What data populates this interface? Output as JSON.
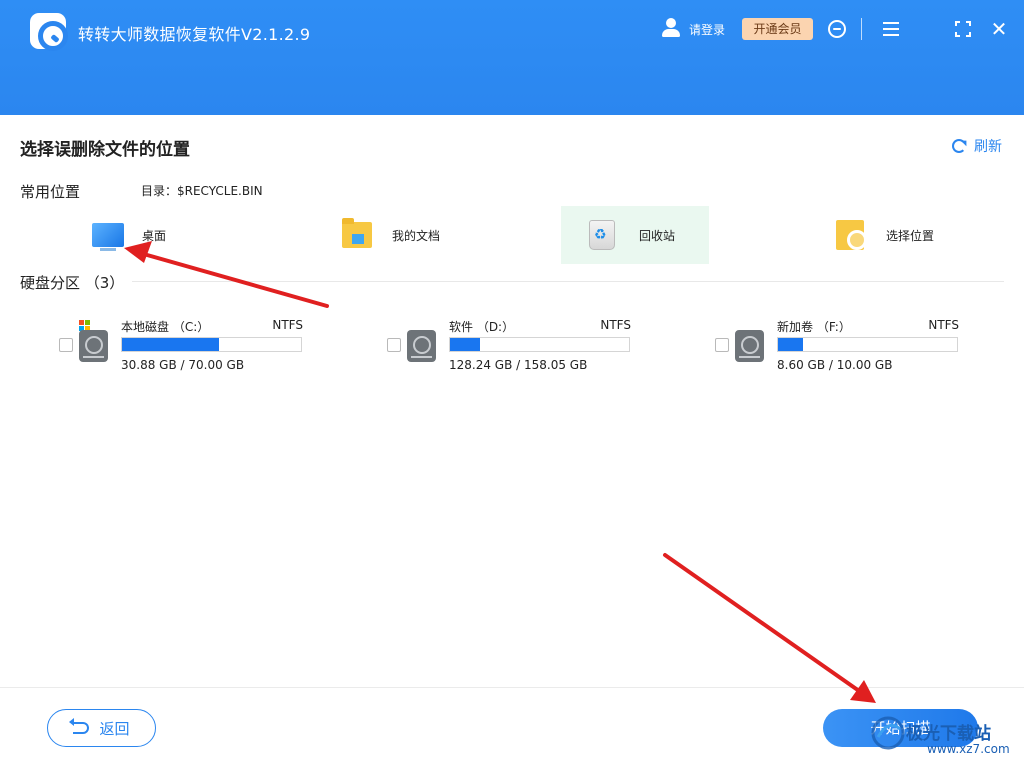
{
  "header": {
    "title": "转转大师数据恢复软件V2.1.2.9",
    "login_label": "请登录",
    "vip_label": "开通会员",
    "icons": [
      "user-icon",
      "support-icon",
      "menu-icon",
      "maximize-icon",
      "close-icon"
    ]
  },
  "main": {
    "section_title": "选择误删除文件的位置",
    "refresh_label": "刷新",
    "common_label": "常用位置",
    "dir_info": "目录：$RECYCLE.BIN",
    "locations": [
      {
        "label": "桌面",
        "icon": "desktop-icon"
      },
      {
        "label": "我的文档",
        "icon": "documents-folder-icon"
      },
      {
        "label": "回收站",
        "icon": "recycle-bin-icon",
        "selected": true
      },
      {
        "label": "选择位置",
        "icon": "folder-search-icon"
      }
    ],
    "partition_label": "硬盘分区 （3）",
    "drives": [
      {
        "name": "本地磁盘 （C:）",
        "fs": "NTFS",
        "size": "30.88 GB / 70.00 GB",
        "used_fraction": 0.54,
        "system": true
      },
      {
        "name": "软件 （D:）",
        "fs": "NTFS",
        "size": "128.24 GB / 158.05 GB",
        "used_fraction": 0.17
      },
      {
        "name": "新加卷 （F:）",
        "fs": "NTFS",
        "size": "8.60 GB / 10.00 GB",
        "used_fraction": 0.14
      }
    ]
  },
  "footer": {
    "back_label": "返回",
    "scan_label": "开始扫描"
  },
  "watermark": {
    "text": "极光下载站",
    "url": "www.xz7.com"
  },
  "colors": {
    "accent": "#2b86ef",
    "bar_fill": "#1976f0",
    "vip_bg": "#fbd4b0",
    "arrow": "#e02020"
  }
}
